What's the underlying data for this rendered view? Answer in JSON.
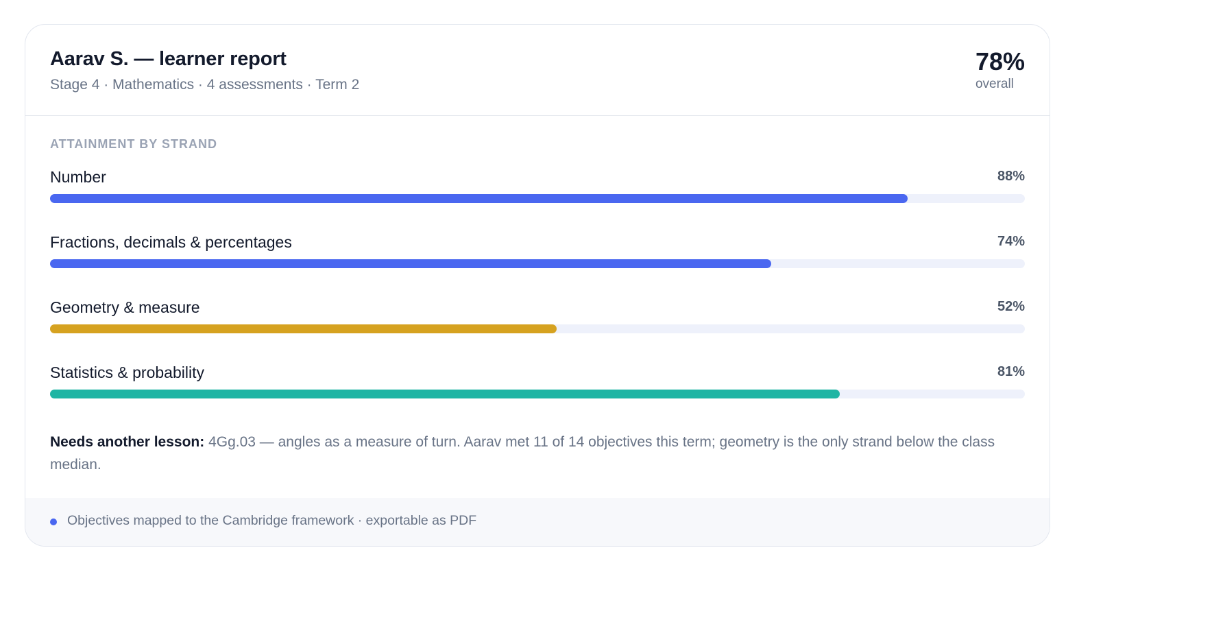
{
  "report": {
    "title": "Aarav S. — learner report",
    "subtitle": "Stage 4 · Mathematics · 4 assessments · Term 2",
    "overall_value": "78%",
    "overall_label": "overall"
  },
  "section": {
    "label": "ATTAINMENT BY STRAND"
  },
  "strands": [
    {
      "name": "Number",
      "percent_label": "88%",
      "value": 88,
      "color": "#4a67f0"
    },
    {
      "name": "Fractions, decimals & percentages",
      "percent_label": "74%",
      "value": 74,
      "color": "#4a67f0"
    },
    {
      "name": "Geometry & measure",
      "percent_label": "52%",
      "value": 52,
      "color": "#d6a220"
    },
    {
      "name": "Statistics & probability",
      "percent_label": "81%",
      "value": 81,
      "color": "#1fb5a4"
    }
  ],
  "note": {
    "label": "Needs another lesson:",
    "text": " 4Gg.03 — angles as a measure of turn. Aarav met 11 of 14 objectives this term; geometry is the only strand below the class median."
  },
  "footer": {
    "text": "Objectives mapped to the Cambridge framework · exportable as PDF",
    "dot_color": "#4a67f0"
  }
}
